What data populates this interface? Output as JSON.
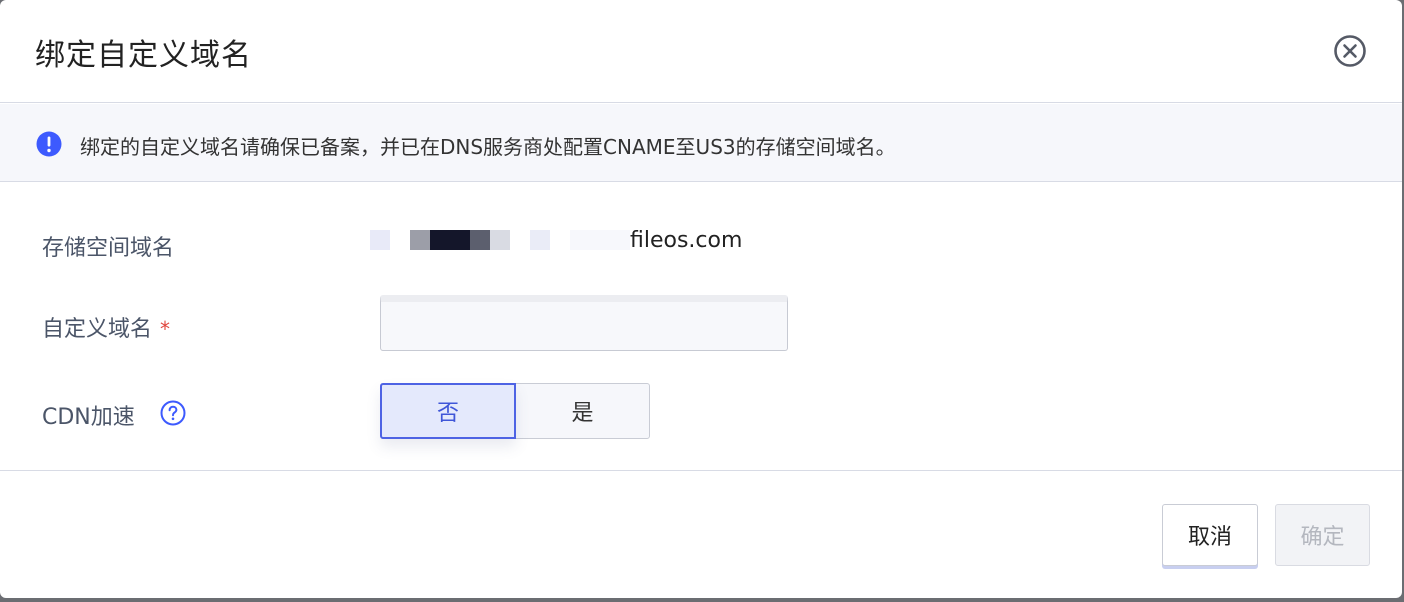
{
  "dialog": {
    "title": "绑定自定义域名",
    "close_icon": "close-circle-icon"
  },
  "notice": {
    "icon": "exclamation-circle-icon",
    "text": "绑定的自定义域名请确保已备案，并已在DNS服务商处配置CNAME至US3的存储空间域名。",
    "icon_color": "#3d5afe"
  },
  "form": {
    "storage_domain": {
      "label": "存储空间域名",
      "value": "fileos.com"
    },
    "custom_domain": {
      "label": "自定义域名",
      "required_mark": "*",
      "value": "",
      "placeholder": ""
    },
    "cdn": {
      "label": "CDN加速",
      "help_icon": "question-circle-icon",
      "options": [
        "否",
        "是"
      ],
      "selected": "否"
    }
  },
  "footer": {
    "cancel_label": "取消",
    "confirm_label": "确定"
  },
  "colors": {
    "accent": "#4e63e4",
    "required": "#e0463e",
    "disabled_text": "#b4b7bf"
  }
}
